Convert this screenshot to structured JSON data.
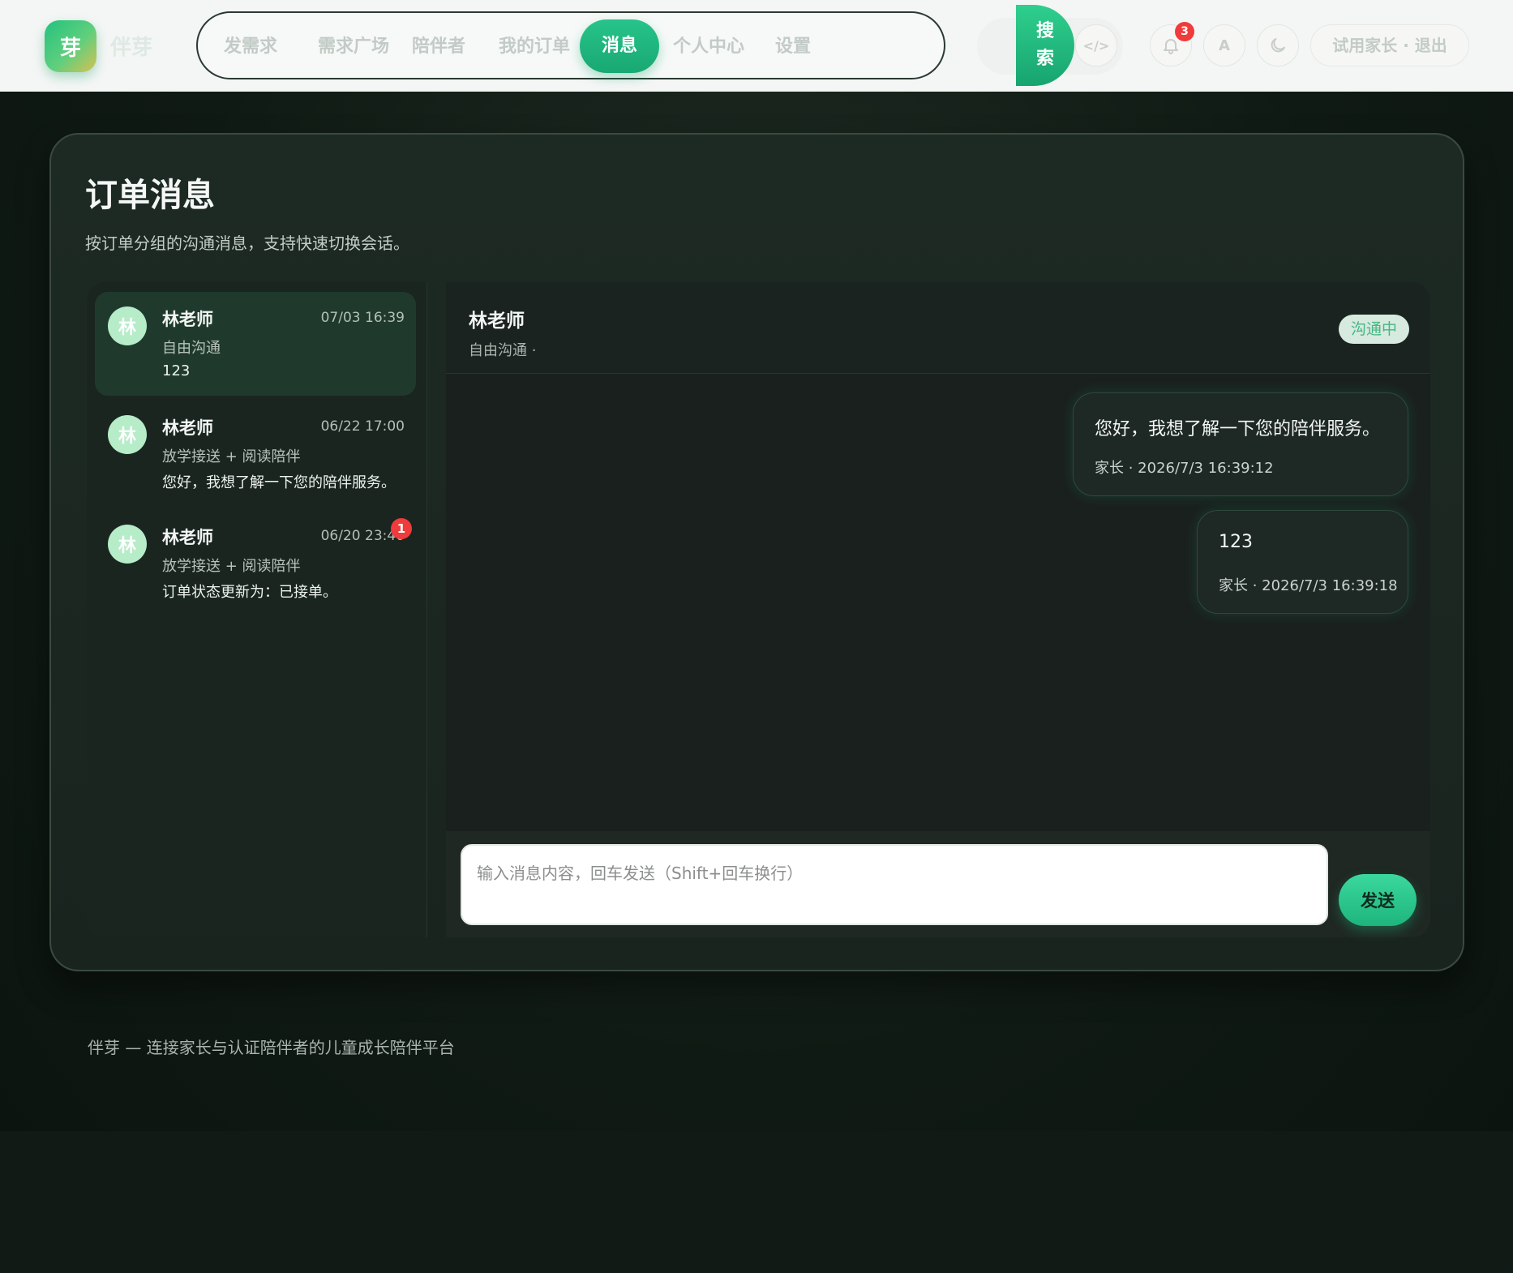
{
  "brand": {
    "mark": "芽",
    "name": "伴芽"
  },
  "nav": {
    "items": [
      {
        "label": "发需求"
      },
      {
        "label": "需求广场"
      },
      {
        "label": "陪伴者"
      },
      {
        "label": "我的订单"
      },
      {
        "label": "消息",
        "active": true
      },
      {
        "label": "个人中心"
      },
      {
        "label": "设置"
      }
    ]
  },
  "toolbar": {
    "search_line1": "搜",
    "search_line2": "索",
    "code_icon": "</>",
    "notification_count": "3",
    "font_label": "A",
    "user_label": "试用家长 · 退出",
    "icons": [
      "code-icon",
      "bell-icon",
      "font-icon",
      "moon-icon"
    ]
  },
  "page": {
    "title": "订单消息",
    "subtitle": "按订单分组的沟通消息，支持快速切换会话。"
  },
  "conversations": [
    {
      "avatar": "林",
      "name": "林老师",
      "time": "07/03 16:39",
      "topic": "自由沟通",
      "preview": "123",
      "active": true,
      "unread": ""
    },
    {
      "avatar": "林",
      "name": "林老师",
      "time": "06/22 17:00",
      "topic": "放学接送 + 阅读陪伴",
      "preview": "您好，我想了解一下您的陪伴服务。",
      "active": false,
      "unread": ""
    },
    {
      "avatar": "林",
      "name": "林老师",
      "time": "06/20 23:40",
      "topic": "放学接送 + 阅读陪伴",
      "preview": "订单状态更新为：已接单。",
      "active": false,
      "unread": "1"
    }
  ],
  "chat": {
    "name": "林老师",
    "subtitle": "自由沟通 ·",
    "status": "沟通中",
    "messages": [
      {
        "text": "您好，我想了解一下您的陪伴服务。",
        "meta": "家长 · 2026/7/3 16:39:12"
      },
      {
        "text": "123",
        "meta": "家长 · 2026/7/3 16:39:18"
      }
    ],
    "input_placeholder": "输入消息内容，回车发送（Shift+回车换行）",
    "send_label": "发送"
  },
  "footer": {
    "text": "伴芽 — 连接家长与认证陪伴者的儿童成长陪伴平台"
  },
  "colors": {
    "accent": "#1fb57d",
    "badge": "#ef3b3b",
    "background": "#101a14"
  }
}
